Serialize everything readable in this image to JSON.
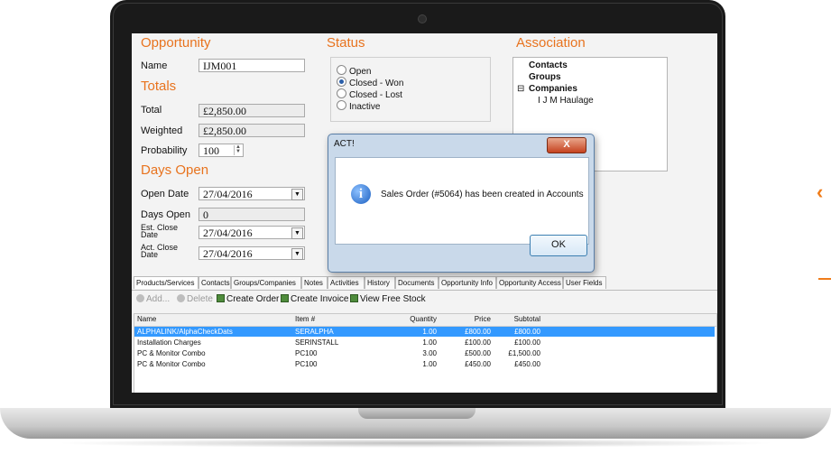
{
  "opportunity": {
    "title": "Opportunity",
    "name_label": "Name",
    "name_value": "IJM001"
  },
  "totals": {
    "title": "Totals",
    "total_label": "Total",
    "total_value": "£2,850.00",
    "weighted_label": "Weighted",
    "weighted_value": "£2,850.00",
    "probability_label": "Probability",
    "probability_value": "100"
  },
  "days_open": {
    "title": "Days Open",
    "open_date_label": "Open Date",
    "open_date_value": "27/04/2016",
    "days_open_label": "Days Open",
    "days_open_value": "0",
    "est_close_label": "Est. Close Date",
    "est_close_value": "27/04/2016",
    "act_close_label": "Act. Close Date",
    "act_close_value": "27/04/2016"
  },
  "status": {
    "title": "Status",
    "options": [
      "Open",
      "Closed - Won",
      "Closed - Lost",
      "Inactive"
    ],
    "selected": "Closed - Won"
  },
  "association": {
    "title": "Association",
    "items": [
      "Contacts",
      "Groups",
      "Companies"
    ],
    "company_child": "I J M Haulage",
    "expander": "⊟"
  },
  "dialog": {
    "title": "ACT!",
    "close_glyph": "X",
    "message": "Sales Order (#5064) has been created in Accounts",
    "ok_label": "OK",
    "icon_glyph": "i"
  },
  "tabs": [
    "Products/Services",
    "Contacts",
    "Groups/Companies",
    "Notes",
    "Activities",
    "History",
    "Documents",
    "Opportunity Info",
    "Opportunity Access",
    "User Fields"
  ],
  "toolbar": {
    "add_label": "Add...",
    "delete_label": "Delete",
    "create_order_label": "Create Order",
    "create_invoice_label": "Create Invoice",
    "view_free_stock_label": "View Free Stock"
  },
  "grid": {
    "headers": [
      "Name",
      "Item #",
      "Quantity",
      "Price",
      "Subtotal"
    ],
    "rows": [
      [
        "ALPHALINK/AlphaCheckDats",
        "SERALPHA",
        "1.00",
        "£800.00",
        "£800.00"
      ],
      [
        "Installation Charges",
        "SERINSTALL",
        "1.00",
        "£100.00",
        "£100.00"
      ],
      [
        "PC & Monitor Combo",
        "PC100",
        "3.00",
        "£500.00",
        "£1,500.00"
      ],
      [
        "PC & Monitor Combo",
        "PC100",
        "1.00",
        "£450.00",
        "£450.00"
      ]
    ],
    "selected_row": 0
  },
  "colors": {
    "section_title": "#e8731e",
    "selection": "#3399ff",
    "laptop_bezel": "#1a1a1a"
  }
}
